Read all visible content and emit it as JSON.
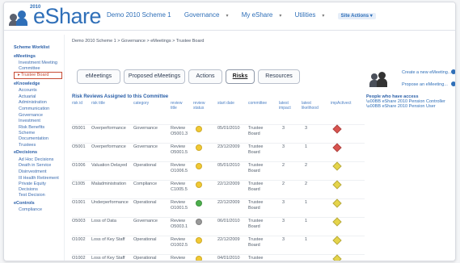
{
  "header": {
    "logo_year": "2010",
    "logo_text": "eShare",
    "nav": [
      {
        "label": "Demo 2010 Scheme 1",
        "caret": ""
      },
      {
        "label": "Governance",
        "caret": "▾"
      },
      {
        "label": "My eShare",
        "caret": "▾"
      },
      {
        "label": "Utilities",
        "caret": "▾"
      }
    ],
    "site_actions": "Site Actions ▾"
  },
  "sidebar": {
    "sections": [
      {
        "title": "Scheme Worklist",
        "items": []
      },
      {
        "title": "eMeetings",
        "items": [
          "Investment Meeting Committee",
          "Trustee Board"
        ]
      },
      {
        "title": "eKnowledge",
        "items": [
          "Accounts",
          "Actuarial",
          "Administration",
          "Communication",
          "Governance",
          "Investment",
          "Risk Benefits",
          "Scheme Documentation",
          "Trustees"
        ]
      },
      {
        "title": "eDecisions",
        "items": [
          "Ad Hoc Decisions",
          "Death in Service",
          "Disinvestment",
          "Ill Health Retirement",
          "Private Equity Decisions",
          "Test Decision"
        ]
      },
      {
        "title": "eControls",
        "items": [
          "Compliance"
        ]
      }
    ],
    "selected": "Trustee Board"
  },
  "breadcrumb": "Demo 2010 Scheme 1 > Governance > eMeetings > Trustee Board",
  "tabs": [
    "eMeetings",
    "Proposed eMeetings",
    "Actions",
    "Risks",
    "Resources"
  ],
  "active_tab": "Risks",
  "section_title": "Risk Reviews Assigned to this Committee",
  "columns": [
    "risk id",
    "risk title",
    "category",
    "review title",
    "review status",
    "start date",
    "committee",
    "latest impact",
    "latest likelihood",
    "impActivect"
  ],
  "rows": [
    {
      "id": "O5001",
      "title": "Overperformance",
      "category": "Governance",
      "review": "Review O5001.3",
      "status_color": "#f2c933",
      "date": "05/01/2010",
      "committee": "Trustee Board",
      "impact": "3",
      "likelihood": "3",
      "ind_color": "#d9534f"
    },
    {
      "id": "O5001",
      "title": "Overperformance",
      "category": "Governance",
      "review": "Review O5001.5",
      "status_color": "#f2c933",
      "date": "23/12/2009",
      "committee": "Trustee Board",
      "impact": "3",
      "likelihood": "1",
      "ind_color": "#d9534f"
    },
    {
      "id": "O1006",
      "title": "Valuation Delayed",
      "category": "Operational",
      "review": "Review O1006.5",
      "status_color": "#f2c933",
      "date": "05/01/2010",
      "committee": "Trustee Board",
      "impact": "2",
      "likelihood": "2",
      "ind_color": "#e5d44a"
    },
    {
      "id": "C1005",
      "title": "Maladministration",
      "category": "Compliance",
      "review": "Review C1005.5",
      "status_color": "#f2c933",
      "date": "22/12/2009",
      "committee": "Trustee Board",
      "impact": "2",
      "likelihood": "2",
      "ind_color": "#e5d44a"
    },
    {
      "id": "O1001",
      "title": "Underperformance",
      "category": "Operational",
      "review": "Review O1001.5",
      "status_color": "#4cae4c",
      "date": "22/12/2009",
      "committee": "Trustee Board",
      "impact": "3",
      "likelihood": "1",
      "ind_color": "#e5d44a"
    },
    {
      "id": "O5003",
      "title": "Loss of Data",
      "category": "Governance",
      "review": "Review O5003.1",
      "status_color": "#999999",
      "date": "06/01/2010",
      "committee": "Trustee Board",
      "impact": "3",
      "likelihood": "1",
      "ind_color": "#e5d44a"
    },
    {
      "id": "O1002",
      "title": "Loss of Key Staff",
      "category": "Operational",
      "review": "Review O1002.5",
      "status_color": "#f2c933",
      "date": "22/12/2009",
      "committee": "Trustee Board",
      "impact": "3",
      "likelihood": "1",
      "ind_color": "#e5d44a"
    },
    {
      "id": "O1002",
      "title": "Loss of Key Staff",
      "category": "Operational",
      "review": "Review",
      "status_color": "#f2c933",
      "date": "04/01/2010",
      "committee": "Trustee",
      "impact": "",
      "likelihood": "",
      "ind_color": "#e5d44a"
    }
  ],
  "right_panel": {
    "create_link": "Create a new eMeeting...",
    "propose_link": "Propose an eMeeting...",
    "people_title": "People who have access",
    "people": [
      "eShare 2010 Pension Controller",
      "eShare 2010 Pension User"
    ]
  },
  "colors": {
    "accent": "#2f6fb8",
    "selected": "#c64b34"
  }
}
